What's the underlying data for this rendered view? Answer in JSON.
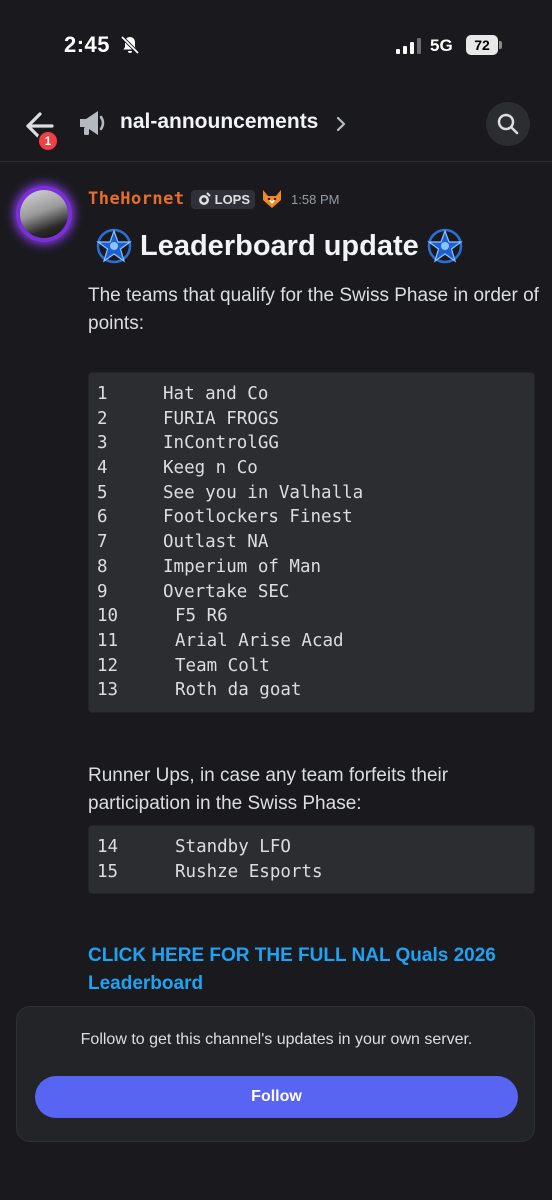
{
  "status_bar": {
    "time": "2:45",
    "network": "5G",
    "battery": "72"
  },
  "header": {
    "back_badge": "1",
    "channel_name": "nal-announcements"
  },
  "message": {
    "author": "TheHornet",
    "tag_label": "LOPS",
    "time": "1:58 PM",
    "heading": "Leaderboard update",
    "intro": "The teams that qualify for the Swiss Phase in order of points:",
    "qualified": [
      {
        "rank": "1",
        "team": "Hat and Co"
      },
      {
        "rank": "2",
        "team": "FURIA FROGS"
      },
      {
        "rank": "3",
        "team": "InControlGG"
      },
      {
        "rank": "4",
        "team": "Keeg n Co"
      },
      {
        "rank": "5",
        "team": "See you in Valhalla"
      },
      {
        "rank": "6",
        "team": "Footlockers Finest"
      },
      {
        "rank": "7",
        "team": "Outlast NA"
      },
      {
        "rank": "8",
        "team": "Imperium of Man"
      },
      {
        "rank": "9",
        "team": "Overtake SEC"
      },
      {
        "rank": "10",
        "team": "F5 R6"
      },
      {
        "rank": "11",
        "team": "Arial Arise Acad"
      },
      {
        "rank": "12",
        "team": "Team Colt"
      },
      {
        "rank": "13",
        "team": "Roth da goat"
      }
    ],
    "runner_ups_intro": "Runner Ups, in case any team forfeits their participation in the Swiss Phase:",
    "runner_ups": [
      {
        "rank": "14",
        "team": "Standby LFO"
      },
      {
        "rank": "15",
        "team": "Rushze Esports"
      }
    ],
    "link_text": "CLICK HERE FOR THE FULL NAL Quals 2026 Leaderboard"
  },
  "follow_panel": {
    "text": "Follow to get this channel's updates in your own server.",
    "button_label": "Follow"
  },
  "colors": {
    "background": "#1a1a1e",
    "author": "#e86c2c",
    "link": "#1fa2f2",
    "follow_button": "#5865f2",
    "badge": "#f23f43"
  }
}
